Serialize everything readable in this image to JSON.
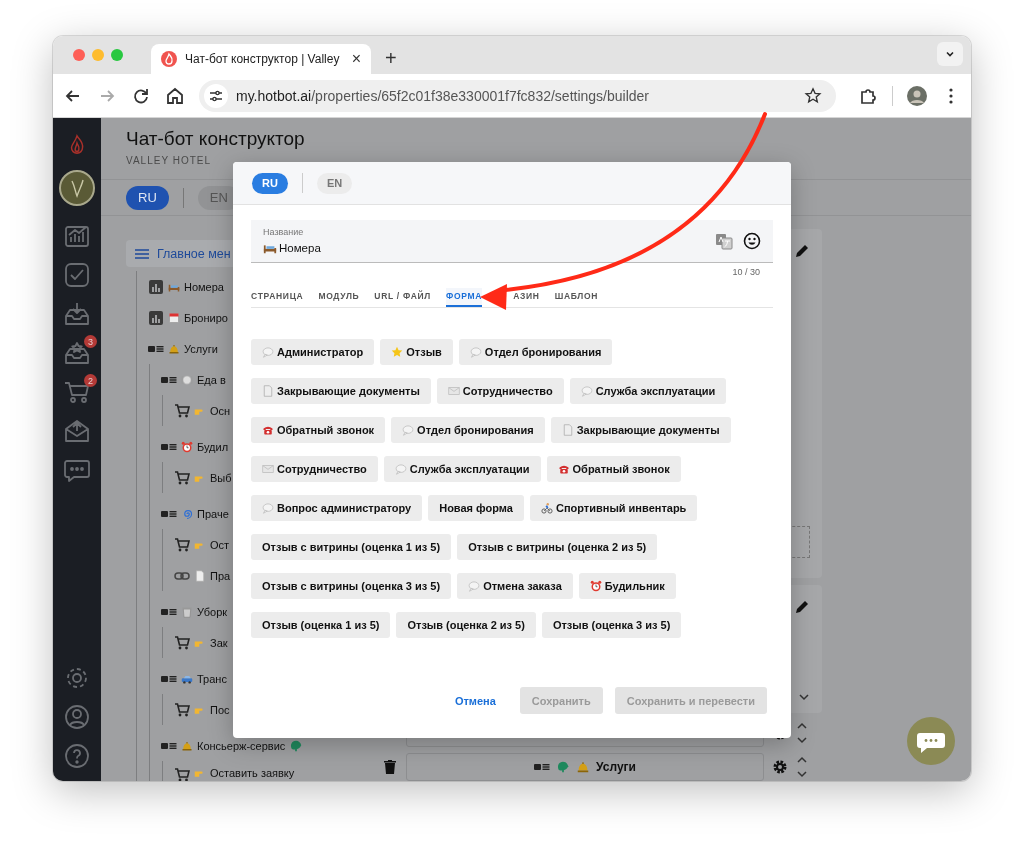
{
  "browser": {
    "tab_title": "Чат-бот конструктор | Valley",
    "tab_close": "×",
    "new_tab": "+",
    "url_host": "my.hotbot.ai",
    "url_path": "/properties/65f2c01f38e330001f7fc832/settings/builder"
  },
  "sidebar": {
    "items": [
      {
        "kind": "chart"
      },
      {
        "kind": "check"
      },
      {
        "kind": "inbox"
      },
      {
        "kind": "inbox-star",
        "badge": "3"
      },
      {
        "kind": "cart",
        "badge": "2"
      },
      {
        "kind": "mail"
      },
      {
        "kind": "chat"
      }
    ],
    "bottom": [
      {
        "kind": "gear"
      },
      {
        "kind": "user"
      },
      {
        "kind": "help"
      }
    ]
  },
  "header": {
    "title": "Чат-бот конструктор",
    "subtitle": "VALLEY HOTEL"
  },
  "languages": [
    {
      "label": "RU",
      "selected": true
    },
    {
      "label": "EN",
      "selected": false
    }
  ],
  "tree": {
    "root": "Главное мен",
    "items": [
      {
        "label": "Номера",
        "kind": "chart",
        "flagged": false
      },
      {
        "label": "Брониро",
        "kind": "chart",
        "flagged": false
      },
      {
        "label": "Услуги",
        "kind": "list",
        "flagged": false,
        "children": [
          {
            "label": "Еда в",
            "kind": "list",
            "flagged": false,
            "children": [
              {
                "label": "Осн",
                "kind": "cart",
                "flagged": false
              }
            ]
          },
          {
            "label": "Будил",
            "kind": "list",
            "flagged": false,
            "children": [
              {
                "label": "Выб",
                "kind": "cart",
                "flagged": false
              }
            ]
          },
          {
            "label": "Праче",
            "kind": "list",
            "flagged": false,
            "children": [
              {
                "label": "Ост",
                "kind": "cart",
                "flagged": false
              },
              {
                "label": "Пра",
                "kind": "link",
                "flagged": false
              }
            ]
          },
          {
            "label": "Уборк",
            "kind": "list",
            "flagged": false,
            "children": [
              {
                "label": "Зак",
                "kind": "cart",
                "flagged": false
              }
            ]
          },
          {
            "label": "Транс",
            "kind": "list",
            "flagged": false,
            "children": [
              {
                "label": "Пос",
                "kind": "cart",
                "flagged": false
              }
            ]
          },
          {
            "label": "Консьерж-сервис",
            "kind": "list",
            "flagged": true,
            "children": [
              {
                "label": "Оставить заявку",
                "kind": "cart",
                "flagged": false
              }
            ]
          }
        ]
      }
    ]
  },
  "editor": {
    "rows": [
      {
        "label": "Услуги",
        "kind": "list",
        "flagged": true
      }
    ]
  },
  "dialog": {
    "languages": [
      {
        "label": "RU",
        "selected": true
      },
      {
        "label": "EN",
        "selected": false
      }
    ],
    "name_field": {
      "label": "Название",
      "value": "Номера",
      "counter": "10 / 30"
    },
    "tabs": [
      {
        "label": "СТРАНИЦА",
        "selected": false
      },
      {
        "label": "МОДУЛЬ",
        "selected": false
      },
      {
        "label": "URL / ФАЙЛ",
        "selected": false
      },
      {
        "label": "ФОРМА",
        "selected": true
      },
      {
        "label": "АЗИН",
        "selected": false
      },
      {
        "label": "ШАБЛОН",
        "selected": false
      }
    ],
    "form_rows": [
      [
        {
          "label": "Администратор",
          "kind": "speech"
        },
        {
          "label": "Отзыв",
          "kind": "star"
        },
        {
          "label": "Отдел бронирования",
          "kind": "speech"
        }
      ],
      [
        {
          "label": "Закрывающие документы",
          "kind": "doc"
        },
        {
          "label": "Сотрудничество",
          "kind": "envelope"
        },
        {
          "label": "Служба эксплуатации",
          "kind": "speech"
        }
      ],
      [
        {
          "label": "Обратный звонок",
          "kind": "phone"
        },
        {
          "label": "Отдел бронирования",
          "kind": "speech"
        },
        {
          "label": "Закрывающие документы",
          "kind": "doc"
        }
      ],
      [
        {
          "label": "Сотрудничество",
          "kind": "envelope"
        },
        {
          "label": "Служба эксплуатации",
          "kind": "speech"
        },
        {
          "label": "Обратный звонок",
          "kind": "phone"
        }
      ],
      [
        {
          "label": "Вопрос администратору",
          "kind": "speech"
        },
        {
          "label": "Новая форма",
          "kind": "plain"
        },
        {
          "label": "Спортивный инвентарь",
          "kind": "bike"
        }
      ],
      [
        {
          "label": "Отзыв с витрины (оценка 1 из 5)",
          "kind": "plain"
        },
        {
          "label": "Отзыв с витрины (оценка 2 из 5)",
          "kind": "plain"
        }
      ],
      [
        {
          "label": "Отзыв с витрины (оценка 3 из 5)",
          "kind": "plain"
        },
        {
          "label": "Отмена заказа",
          "kind": "speech"
        },
        {
          "label": "Будильник",
          "kind": "alarm"
        }
      ],
      [
        {
          "label": "Отзыв (оценка 1 из 5)",
          "kind": "plain"
        },
        {
          "label": "Отзыв (оценка 2 из 5)",
          "kind": "plain"
        },
        {
          "label": "Отзыв (оценка 3 из 5)",
          "kind": "plain"
        }
      ]
    ],
    "actions": [
      {
        "label": "Отмена",
        "kind": "link",
        "disabled": false
      },
      {
        "label": "Сохранить",
        "kind": "button",
        "disabled": true
      },
      {
        "label": "Сохранить и перевести",
        "kind": "button",
        "disabled": true
      }
    ]
  }
}
